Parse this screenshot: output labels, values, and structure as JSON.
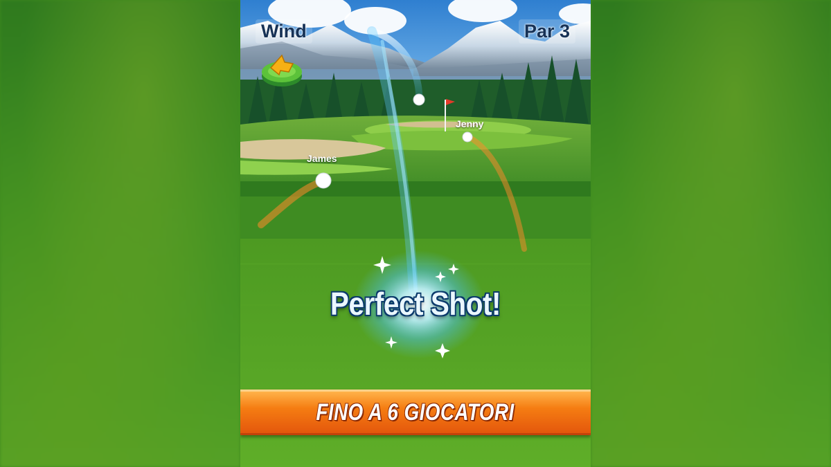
{
  "hud": {
    "wind_label": "Wind",
    "par_label": "Par 3",
    "wind_indicator_icon": "wind-arrow-icon"
  },
  "players": [
    {
      "name": "Jenny"
    },
    {
      "name": "James"
    }
  ],
  "feedback": {
    "message": "Perfect Shot!"
  },
  "banner": {
    "text": "FINO A 6 GIOCATORI"
  },
  "colors": {
    "banner_orange": "#f57d12",
    "text_navy": "#173256",
    "fairway_green": "#4f9a22",
    "flag_red": "#e53a2a"
  }
}
